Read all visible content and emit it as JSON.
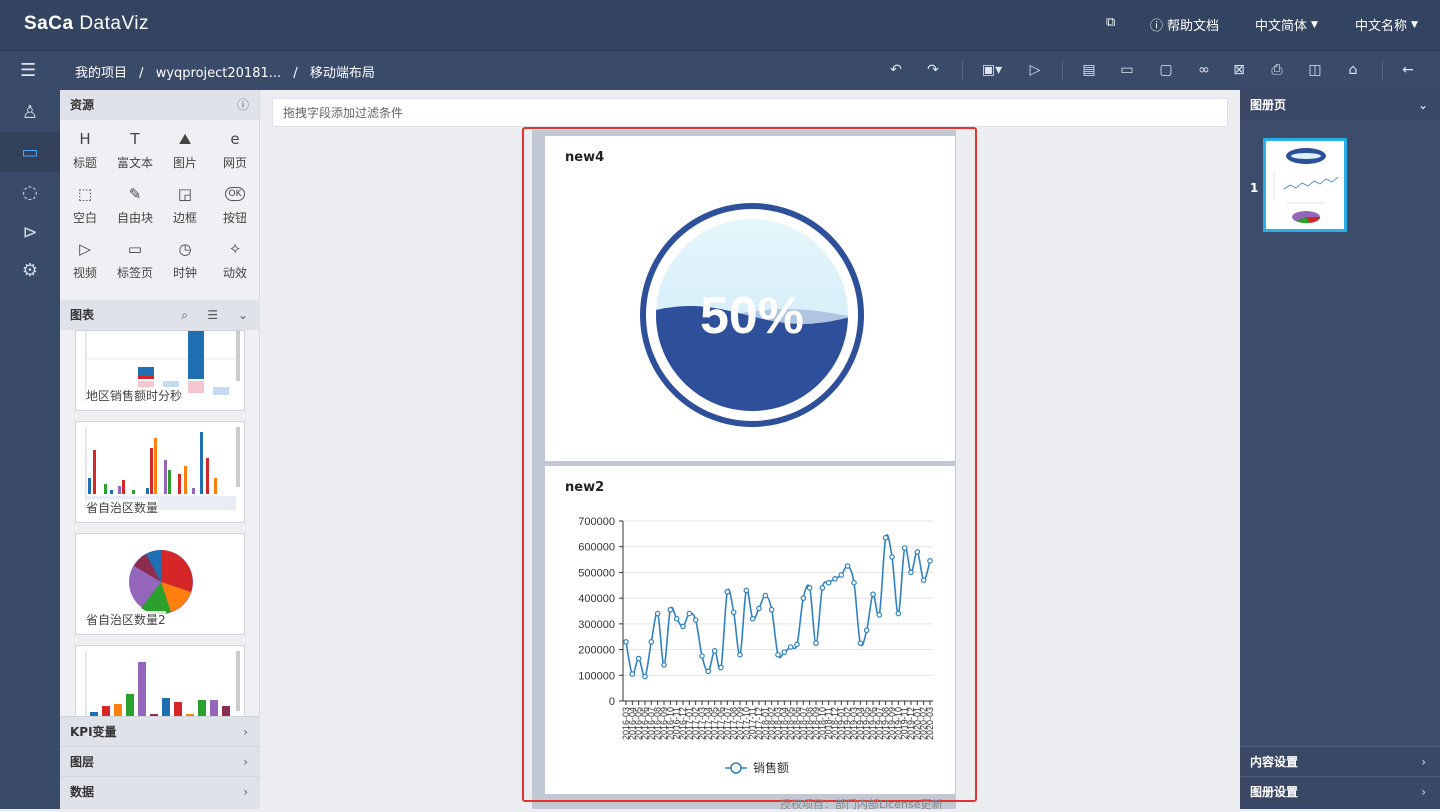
{
  "app": {
    "logo_prefix": "Sa",
    "logo_mid": "Ca",
    "logo_suffix": " DataViz"
  },
  "topbar": {
    "help": "帮助文档",
    "lang": "中文简体",
    "name": "中文名称"
  },
  "breadcrumb": {
    "root": "我的项目",
    "project": "wyqproject20181...",
    "page": "移动端布局",
    "sep": "/"
  },
  "left_panel": {
    "resources_title": "资源",
    "widgets": [
      {
        "icon": "heading-icon",
        "glyph": "H",
        "label": "标题"
      },
      {
        "icon": "richtext-icon",
        "glyph": "T",
        "label": "富文本"
      },
      {
        "icon": "image-icon",
        "glyph": "⛰",
        "label": "图片"
      },
      {
        "icon": "webpage-icon",
        "glyph": "e",
        "label": "网页"
      },
      {
        "icon": "blank-icon",
        "glyph": "⬚",
        "label": "空白"
      },
      {
        "icon": "freeblock-icon",
        "glyph": "✎",
        "label": "自由块"
      },
      {
        "icon": "border-icon",
        "glyph": "◲",
        "label": "边框"
      },
      {
        "icon": "button-icon",
        "glyph": "OK",
        "label": "按钮"
      },
      {
        "icon": "video-icon",
        "glyph": "▷",
        "label": "视频"
      },
      {
        "icon": "tabpage-icon",
        "glyph": "▭",
        "label": "标签页"
      },
      {
        "icon": "clock-icon",
        "glyph": "◷",
        "label": "时钟"
      },
      {
        "icon": "animation-icon",
        "glyph": "✧",
        "label": "动效"
      }
    ],
    "charts_title": "图表",
    "chart_thumbs": [
      "地区销售额时分秒",
      "省自治区数量",
      "省自治区数量2",
      ""
    ],
    "accordions": [
      "KPI变量",
      "图层",
      "数据"
    ]
  },
  "canvas": {
    "filter_placeholder": "拖拽字段添加过滤条件",
    "license_text": "授权项目：部门内部License更新"
  },
  "cards": {
    "gauge": {
      "title": "new4",
      "value_text": "50%",
      "fill_fraction": 0.5
    },
    "line": {
      "title": "new2"
    }
  },
  "colors": {
    "gauge_dark": "#2e4f9a",
    "gauge_light": "#dcf3fb",
    "line": "#2f82c0",
    "topbar": "#334460",
    "highlight": "#e3342f"
  },
  "chart_data": {
    "type": "line",
    "title": "",
    "xlabel": "",
    "ylabel": "",
    "ylim": [
      0,
      700000
    ],
    "y_ticks": [
      "700000",
      "600000",
      "500000",
      "400000",
      "300000",
      "200000",
      "100000",
      "0"
    ],
    "series": [
      {
        "name": "销售额",
        "values": [
          230000,
          105000,
          165000,
          95000,
          230000,
          340000,
          140000,
          355000,
          320000,
          290000,
          340000,
          315000,
          175000,
          115000,
          195000,
          130000,
          425000,
          345000,
          180000,
          430000,
          320000,
          360000,
          410000,
          355000,
          180000,
          190000,
          210000,
          220000,
          400000,
          440000,
          225000,
          440000,
          460000,
          475000,
          490000,
          525000,
          460000,
          225000,
          275000,
          415000,
          335000,
          635000,
          560000,
          340000,
          595000,
          500000,
          580000,
          470000,
          545000
        ]
      }
    ],
    "x": [
      "2016-03",
      "2016-04",
      "2016-05",
      "2016-06",
      "2016-07",
      "2016-08",
      "2016-09",
      "2016-10",
      "2016-11",
      "2016-12",
      "2017-01",
      "2017-02",
      "2017-03",
      "2017-04",
      "2017-05",
      "2017-06",
      "2017-07",
      "2017-08",
      "2017-09",
      "2017-10",
      "2017-11",
      "2017-12",
      "2018-01",
      "2018-02",
      "2018-03",
      "2018-04",
      "2018-05",
      "2018-06",
      "2018-07",
      "2018-08",
      "2018-09",
      "2018-10",
      "2018-11",
      "2018-12",
      "2019-01",
      "2019-02",
      "2019-03",
      "2019-04",
      "2019-05",
      "2019-06",
      "2019-07",
      "2019-08",
      "2019-09",
      "2019-10",
      "2019-11",
      "2019-12",
      "2020-01",
      "2020-02",
      "2020-03"
    ],
    "legend_position": "bottom-center"
  },
  "right_panel": {
    "pages_title": "图册页",
    "page_number": "1",
    "content_settings": "内容设置",
    "album_settings": "图册设置"
  }
}
